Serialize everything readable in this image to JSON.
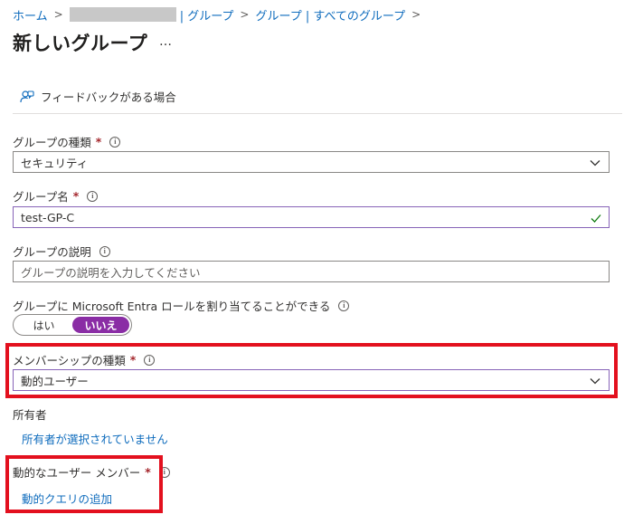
{
  "breadcrumb": {
    "home": "ホーム",
    "group_one": "| グループ",
    "group_two": "グループ | すべてのグループ",
    "sep": ">"
  },
  "page": {
    "title": "新しいグループ",
    "more": "…"
  },
  "feedback": {
    "label": "フィードバックがある場合"
  },
  "form": {
    "group_type": {
      "label": "グループの種類",
      "required": "*",
      "value": "セキュリティ"
    },
    "group_name": {
      "label": "グループ名",
      "required": "*",
      "value": "test-GP-C"
    },
    "group_description": {
      "label": "グループの説明",
      "placeholder": "グループの説明を入力してください"
    },
    "entra_role": {
      "label": "グループに Microsoft Entra ロールを割り当てることができる",
      "options": [
        "はい",
        "いいえ"
      ],
      "selected": "いいえ"
    },
    "membership_type": {
      "label": "メンバーシップの種類",
      "required": "*",
      "value": "動的ユーザー"
    },
    "owners": {
      "label": "所有者",
      "link": "所有者が選択されていません"
    },
    "dynamic_members": {
      "label": "動的なユーザー メンバー",
      "required": "*",
      "link": "動的クエリの追加"
    }
  },
  "info_glyph": "i",
  "colors": {
    "link": "#0f6cbd",
    "accent_purple": "#8a2da5",
    "required": "#a4262c",
    "highlight": "#e3101e",
    "success": "#107c10"
  }
}
